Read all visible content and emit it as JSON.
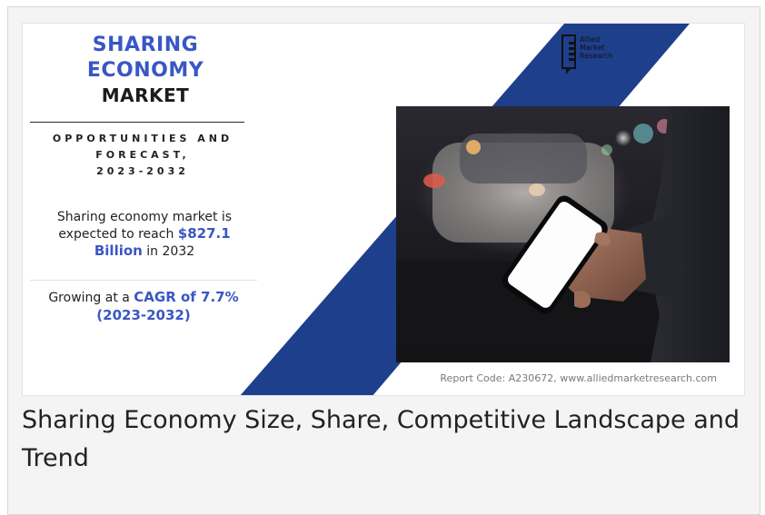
{
  "infographic": {
    "title_line1": "SHARING",
    "title_line2": "ECONOMY",
    "title_line3": "MARKET",
    "forecast_line1": "OPPORTUNITIES AND",
    "forecast_line2": "FORECAST,",
    "forecast_line3": "2023-2032",
    "reach_text_1": "Sharing economy market is",
    "reach_text_2": "expected to reach",
    "reach_value": "$827.1",
    "reach_unit": "Billion",
    "reach_text_3": "in 2032",
    "cagr_text": "Growing at a",
    "cagr_value": "CAGR of 7.7%",
    "cagr_period": "(2023-2032)",
    "logo_line1": "Allied",
    "logo_line2": "Market",
    "logo_line3": "Research",
    "report_code": "Report Code: A230672, www.alliedmarketresearch.com"
  },
  "caption": "Sharing Economy  Size, Share, Competitive Landscape and Trend",
  "colors": {
    "accent_blue": "#3a56c5",
    "diagonal_blue": "#1e3f8c",
    "frame_bg": "#f4f4f4"
  }
}
